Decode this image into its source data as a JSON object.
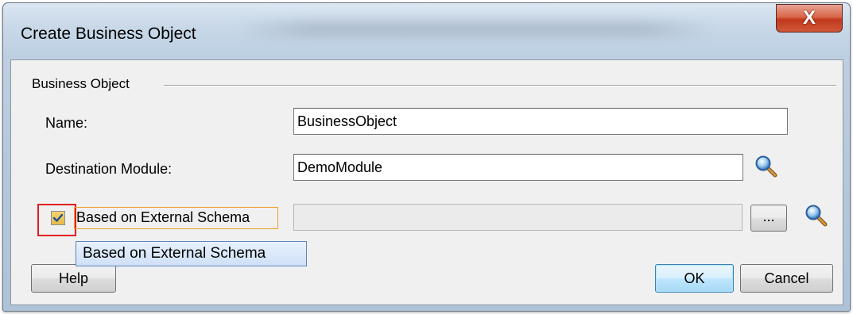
{
  "dialog": {
    "title": "Create Business Object",
    "close_glyph": "X"
  },
  "group": {
    "title": "Business Object"
  },
  "fields": {
    "name_label": "Name:",
    "name_value": "BusinessObject",
    "destination_label": "Destination Module:",
    "destination_value": "DemoModule",
    "schema_checkbox_label": "Based on External Schema",
    "schema_checkbox_checked": true,
    "schema_value": "",
    "browse_label": "..."
  },
  "tooltip": {
    "text": "Based on External Schema"
  },
  "buttons": {
    "help": "Help",
    "ok": "OK",
    "cancel": "Cancel"
  },
  "icons": {
    "destination_search": "search-icon",
    "schema_search": "search-icon",
    "close": "close-icon",
    "check": "checkmark-icon"
  },
  "colors": {
    "highlight_red": "#e02020",
    "highlight_orange": "#f0a030",
    "close_button": "#c0391c"
  }
}
